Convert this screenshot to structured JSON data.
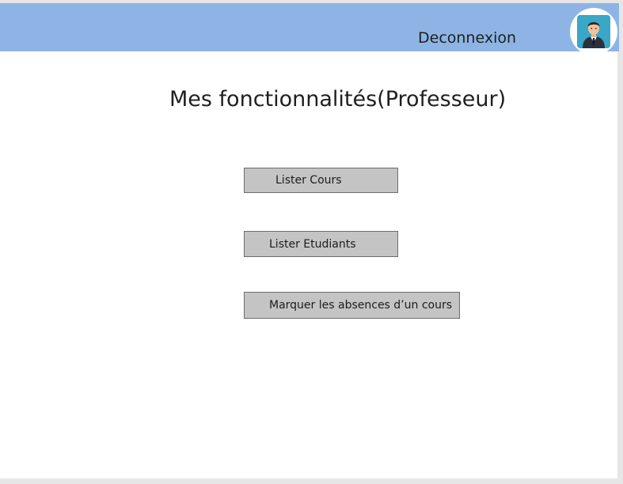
{
  "header": {
    "logout_label": "Deconnexion",
    "avatar_icon": "user-avatar-icon",
    "background_color": "#8db4e4"
  },
  "main": {
    "title": "Mes fonctionnalités(Professeur)",
    "buttons": [
      {
        "label": "Lister Cours"
      },
      {
        "label": "Lister Etudiants"
      },
      {
        "label": "Marquer les absences d’un cours"
      }
    ]
  }
}
